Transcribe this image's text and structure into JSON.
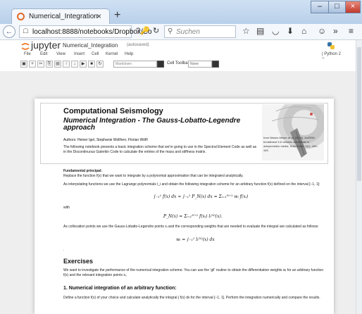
{
  "browser": {
    "tab_title": "Numerical_Integration",
    "tab_close": "×",
    "new_tab": "+",
    "url": "localhost:8888/notebooks/Dropbox/Co",
    "search_placeholder": "Suchen",
    "window_controls": {
      "minimize": "–",
      "maximize": "□",
      "close": "×"
    },
    "nav_icons": [
      "star-icon",
      "reader-icon",
      "pocket-icon",
      "download-icon",
      "home-icon",
      "sync-icon",
      "overflow-icon",
      "menu-icon"
    ]
  },
  "jupyter": {
    "brand": "jupyter",
    "notebook_name": "Numerical_Integration",
    "autosave": "(autosaved)",
    "menus": [
      "File",
      "Edit",
      "View",
      "Insert",
      "Cell",
      "Kernel",
      "Help"
    ],
    "kernel": "Python 2",
    "toolbar_icons": [
      "save-icon",
      "add-icon",
      "cut-icon",
      "copy-icon",
      "paste-icon",
      "move-up-icon",
      "move-down-icon",
      "run-icon",
      "stop-icon",
      "restart-icon"
    ],
    "cell_type": "Markdown",
    "cell_toolbar_label": "Cell Toolbar:",
    "cell_toolbar_value": "None"
  },
  "notebook": {
    "title": "Computational Seismology",
    "subtitle": "Numerical Integration - The Gauss-Lobatto-Legendre approach",
    "authors": "Authors: Heiner Igel, Stephanie Wollherr, Florian Wölfl",
    "intro": "The following notebook presents a basic integration scheme that we're going to use in the Spectral Element Code as well as in the Discontinuous Galerkin Code to calculate the entries of the mass and stiffness matrix.",
    "image_caption": "from Nissen-Meyer et al. (2014), AxiSEM: broadband 3-D seismic wavefields in axisymmetric media, Solid Earth, 5(1), 425–445",
    "principle_heading": "Fundamental principal:",
    "principle_text": "Replace the function f(x) that we want to integrate by a polynomial approximation that can be integrated analytically.",
    "interp_text": "As interpolating functions we use the Lagrange polynomials l_i and obtain the following integration scheme for an arbitrary function f(x) defined on the interval [−1, 1]:",
    "eq1": "∫₋₁¹ f(x) dx ≈ ∫₋₁¹ P_N(x) dx = Σᵢ₌₁ᴺ⁺¹ wᵢ f(xᵢ)",
    "with": "with",
    "eq2": "P_N(x) = Σᵢ₌₁ᴺ⁺¹ f(xᵢ) lᵢ⁽ᴺ⁾(x).",
    "colloc_text": "As collocation points we use the Gauss-Lobatto-Legendre points xᵢ and the corresponding weights that are needed to evaluate the integral are calculated as follows:",
    "eq3": "wᵢ = ∫₋₁¹ lᵢ⁽ᴺ⁾(x) dx",
    "dot": ".",
    "exercises_heading": "Exercises",
    "exercises_text": "We want to investigate the performance of the numerical integration scheme. You can use the 'gll' routine to obtain the differentiation weights wᵢ for an arbitrary function f(x) and the relevant integration points xᵢ.",
    "ex1_heading": "1. Numerical integration of an arbitrary function:",
    "ex1_text": "Define a function f(x) of your choice and calculate analytically the integral ∫ f(x) dx for the interval [−1, 1]. Perform the integration numerically and compare the results."
  },
  "colors": {
    "jupyter_orange": "#f37726",
    "firefox_tab_icon": "#e06a28",
    "title_bar": "#c4d7ee"
  }
}
